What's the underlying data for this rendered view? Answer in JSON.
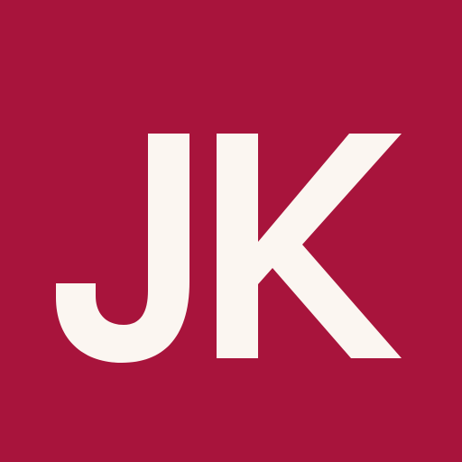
{
  "avatar": {
    "initials": "JK",
    "background_color": "#a8143c",
    "text_color": "#fbf6f1"
  }
}
